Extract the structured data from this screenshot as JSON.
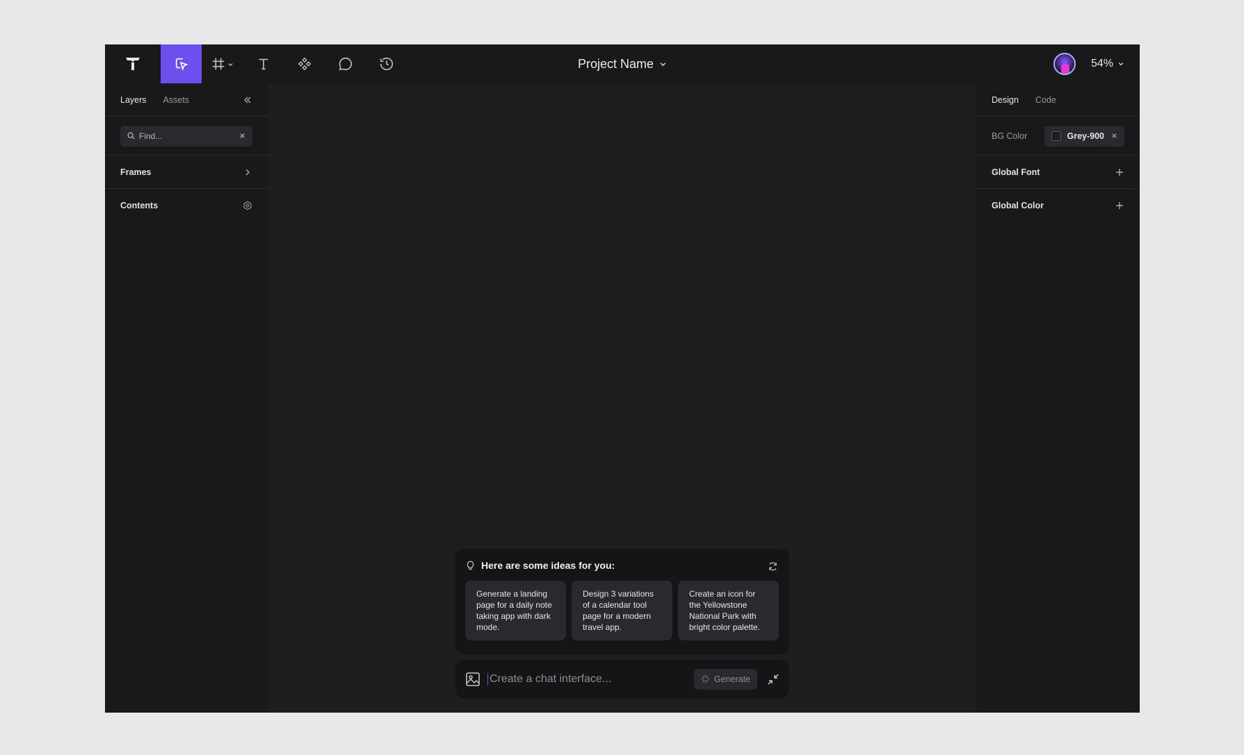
{
  "topbar": {
    "project_name": "Project Name",
    "zoom": "54%",
    "tools": [
      "select",
      "frame",
      "text",
      "components",
      "comments",
      "history"
    ],
    "active_tool": "select",
    "accent_color": "#6d4ff0"
  },
  "left_panel": {
    "tabs": [
      {
        "label": "Layers"
      },
      {
        "label": "Assets"
      }
    ],
    "search": {
      "placeholder": "Find..."
    },
    "sections": [
      {
        "label": "Frames"
      },
      {
        "label": "Contents"
      }
    ]
  },
  "right_panel": {
    "tabs": [
      {
        "label": "Design"
      },
      {
        "label": "Code"
      }
    ],
    "bg_color": {
      "label": "BG Color",
      "value": "Grey-900"
    },
    "sections": [
      {
        "label": "Global Font"
      },
      {
        "label": "Global Color"
      }
    ]
  },
  "ideas": {
    "heading": "Here are some ideas for you:",
    "cards": [
      {
        "text": "Generate a landing page for a daily note taking app with dark mode."
      },
      {
        "text": "Design 3 variations of a calendar tool page for a modern travel app."
      },
      {
        "text": "Create an icon for the Yellowstone National Park with bright color palette."
      }
    ]
  },
  "chat": {
    "placeholder": "Create a chat interface...",
    "generate_label": "Generate"
  }
}
